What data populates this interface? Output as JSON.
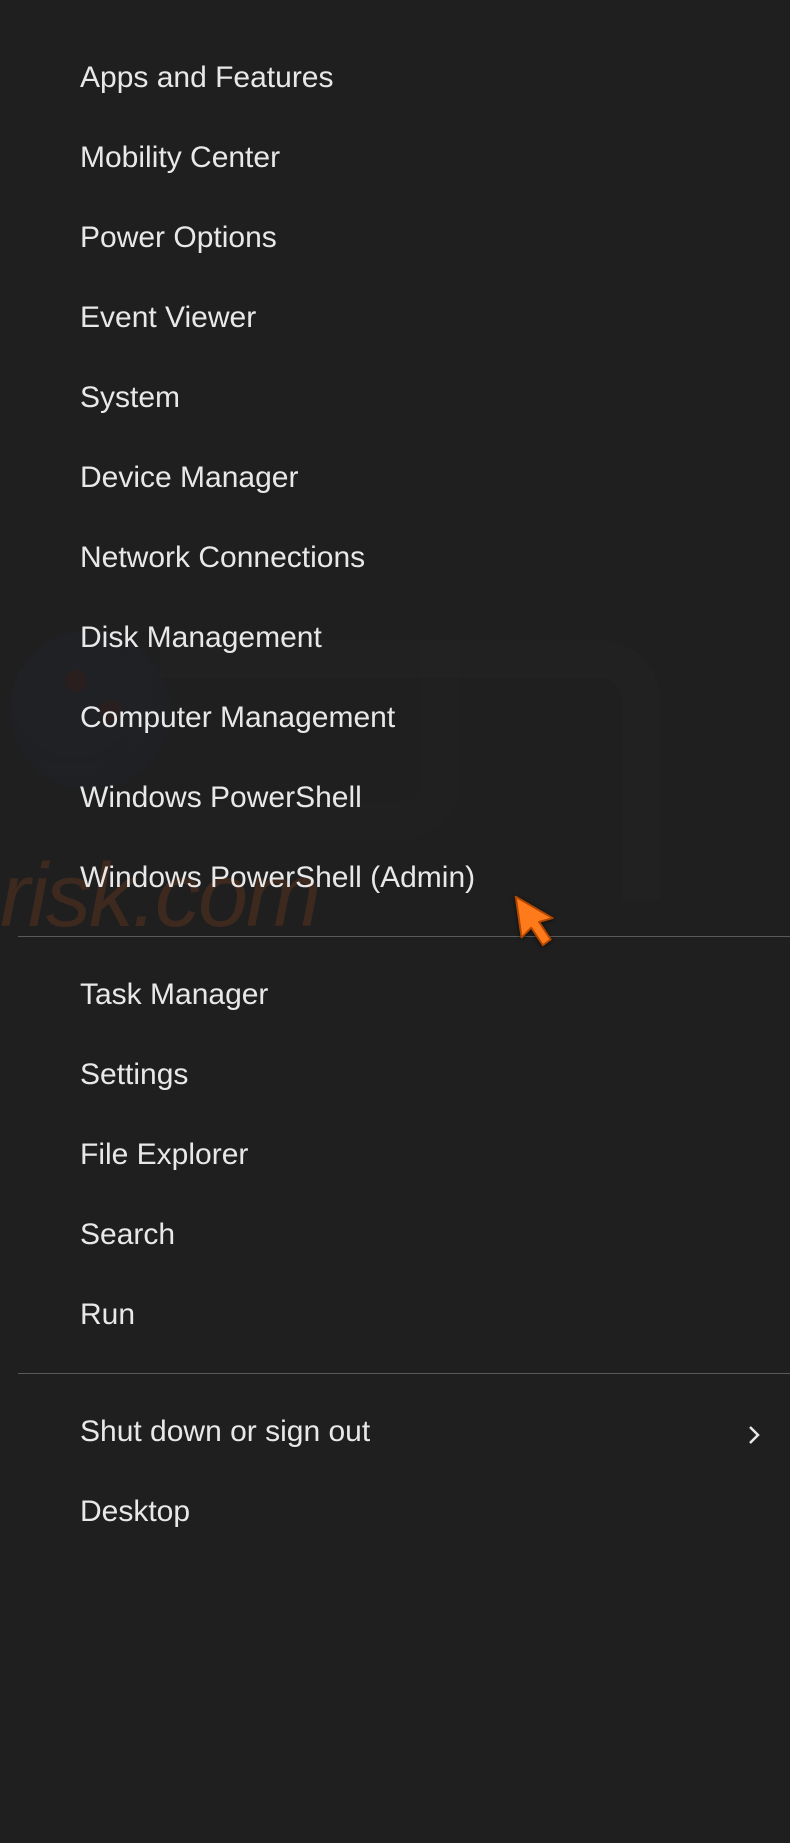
{
  "menu": {
    "group1": [
      {
        "id": "apps-and-features",
        "label": "Apps and Features"
      },
      {
        "id": "mobility-center",
        "label": "Mobility Center"
      },
      {
        "id": "power-options",
        "label": "Power Options"
      },
      {
        "id": "event-viewer",
        "label": "Event Viewer"
      },
      {
        "id": "system",
        "label": "System"
      },
      {
        "id": "device-manager",
        "label": "Device Manager"
      },
      {
        "id": "network-connections",
        "label": "Network Connections"
      },
      {
        "id": "disk-management",
        "label": "Disk Management"
      },
      {
        "id": "computer-management",
        "label": "Computer Management"
      },
      {
        "id": "windows-powershell",
        "label": "Windows PowerShell"
      },
      {
        "id": "windows-powershell-admin",
        "label": "Windows PowerShell (Admin)"
      }
    ],
    "group2": [
      {
        "id": "task-manager",
        "label": "Task Manager"
      },
      {
        "id": "settings",
        "label": "Settings"
      },
      {
        "id": "file-explorer",
        "label": "File Explorer"
      },
      {
        "id": "search",
        "label": "Search"
      },
      {
        "id": "run",
        "label": "Run"
      }
    ],
    "group3": [
      {
        "id": "shut-down-or-sign-out",
        "label": "Shut down or sign out",
        "submenu": true
      },
      {
        "id": "desktop",
        "label": "Desktop"
      }
    ]
  },
  "cursor_target": "windows-powershell-admin",
  "watermark_text": "risk.com"
}
